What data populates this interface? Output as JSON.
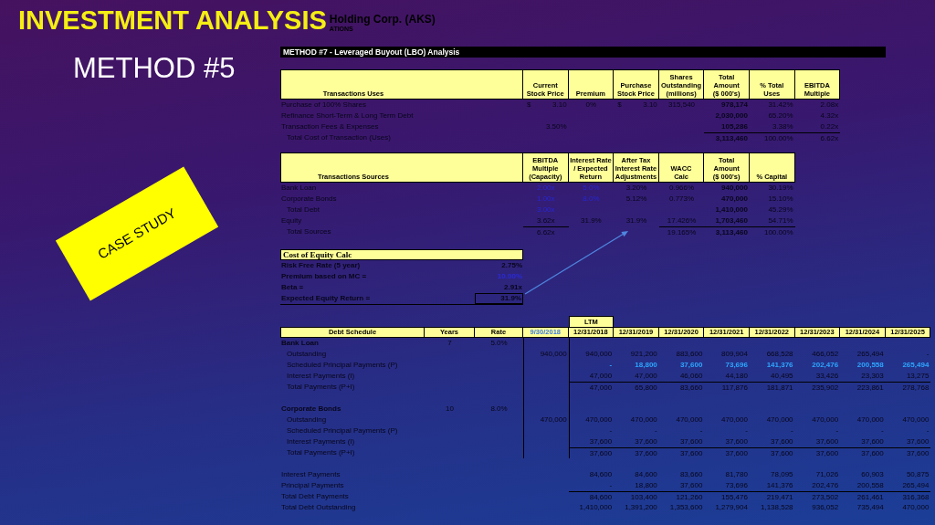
{
  "slide": {
    "title": "INVESTMENT ANALYSIS",
    "subtitle": "METHOD #5",
    "sticker": "CASE STUDY"
  },
  "sheet": {
    "company": "Holding Corp. (AKS)",
    "company_note": "ATIONS",
    "banner": "METHOD #7 - Leveraged Buyout (LBO) Analysis"
  },
  "uses": {
    "title": "Transactions Uses",
    "columns": [
      {
        "lines": [
          "Current",
          "Stock Price"
        ],
        "kind": "value"
      },
      {
        "lines": [
          "Premium"
        ],
        "kind": "center"
      },
      {
        "lines": [
          "Purchase",
          "Stock Price"
        ],
        "kind": "value"
      },
      {
        "lines": [
          "Shares",
          "Outstanding",
          "(millions)"
        ],
        "kind": "center"
      },
      {
        "lines": [
          "Total",
          "Amount",
          "($ 000's)"
        ],
        "kind": "total"
      },
      {
        "lines": [
          "% Total",
          "Uses"
        ],
        "kind": "value"
      },
      {
        "lines": [
          "EBITDA",
          "Multiple"
        ],
        "kind": "value"
      }
    ],
    "rows": [
      {
        "label": "Purchase of 100% Shares",
        "kind": "item",
        "cells": [
          {
            "symbol": "$",
            "text": "3.10"
          },
          "0%",
          {
            "symbol": "$",
            "text": "3.10"
          },
          "315,540",
          "978,174",
          "31.42%",
          "2.08x"
        ]
      },
      {
        "label": "Refinance Short-Term & Long Term Debt",
        "kind": "item",
        "cells": [
          null,
          null,
          null,
          null,
          "2,030,000",
          "65.20%",
          "4.32x"
        ]
      },
      {
        "label": "Transaction Fees & Expenses",
        "kind": "item",
        "cells": [
          "3.50%",
          null,
          null,
          null,
          "105,286",
          "3.38%",
          "0.22x"
        ]
      },
      {
        "label": "Total Cost of Transaction (Uses)",
        "kind": "total",
        "cells": [
          null,
          null,
          null,
          null,
          "3,113,460",
          "100.00%",
          "6.62x"
        ]
      }
    ]
  },
  "sources": {
    "title": "Transactions Sources",
    "columns": [
      {
        "lines": [
          "EBITDA",
          "Multiple",
          "(Capacity)"
        ],
        "kind": "center"
      },
      {
        "lines": [
          "Interest Rate",
          "/ Expected",
          "Return"
        ],
        "kind": "center"
      },
      {
        "lines": [
          "After Tax",
          "Interest Rate",
          "Adjustments"
        ],
        "kind": "center"
      },
      {
        "lines": [
          "WACC",
          "Calc"
        ],
        "kind": "center"
      },
      {
        "lines": [
          "Total",
          "Amount",
          "($ 000's)"
        ],
        "kind": "total"
      },
      {
        "lines": [
          "% Capital"
        ],
        "kind": "value"
      }
    ],
    "rows": [
      {
        "label": "Bank Loan",
        "kind": "item",
        "cells": [
          {
            "text": "2.00x",
            "kind": "input"
          },
          {
            "text": "5.0%",
            "kind": "input"
          },
          "3.20%",
          "0.966%",
          "940,000",
          "30.19%"
        ]
      },
      {
        "label": "Corporate Bonds",
        "kind": "item",
        "cells": [
          {
            "text": "1.00x",
            "kind": "input"
          },
          {
            "text": "8.0%",
            "kind": "input"
          },
          "5.12%",
          "0.773%",
          "470,000",
          "15.10%"
        ]
      },
      {
        "label": "Total Debt",
        "kind": "subtotal",
        "cells": [
          {
            "text": "3.00x",
            "kind": "input"
          },
          null,
          null,
          null,
          "1,410,000",
          "45.29%"
        ]
      },
      {
        "label": "Equity",
        "kind": "item",
        "cells": [
          "3.62x",
          "31.9%",
          "31.9%",
          "17.426%",
          "1,703,460",
          "54.71%"
        ]
      },
      {
        "label": "Total Sources",
        "kind": "total",
        "cells": [
          "6.62x",
          null,
          null,
          "19.165%",
          "3,113,460",
          "100.00%"
        ]
      }
    ]
  },
  "equity": {
    "title": "Cost of Equity Calc",
    "rows": [
      {
        "label": "Risk Free Rate (5 year)",
        "value": "2.75%",
        "kind": "item"
      },
      {
        "label": "Premium based on MC =",
        "value": "10.00%",
        "kind": "input"
      },
      {
        "label": "Beta =",
        "value": "2.91x",
        "kind": "item"
      },
      {
        "label": "Expected Equity Return =",
        "value": "31.9%",
        "kind": "result"
      }
    ]
  },
  "debt": {
    "title": "Debt Schedule",
    "param_headers": [
      "Years",
      "Rate"
    ],
    "columns": [
      {
        "label": "9/30/2018",
        "kind": "current"
      },
      {
        "label": "12/31/2018",
        "kind": "period",
        "group": "LTM"
      },
      {
        "label": "12/31/2019",
        "kind": "period"
      },
      {
        "label": "12/31/2020",
        "kind": "period"
      },
      {
        "label": "12/31/2021",
        "kind": "period"
      },
      {
        "label": "12/31/2022",
        "kind": "period"
      },
      {
        "label": "12/31/2023",
        "kind": "period"
      },
      {
        "label": "12/31/2024",
        "kind": "period"
      },
      {
        "label": "12/31/2025",
        "kind": "period"
      }
    ],
    "sections": [
      {
        "name": "Bank Loan",
        "years": "7",
        "rate": "5.0%",
        "rows": [
          {
            "label": "Outstanding",
            "kind": "item",
            "cells": [
              "940,000",
              "940,000",
              "921,200",
              "883,600",
              "809,904",
              "668,528",
              "466,052",
              "265,494",
              "-"
            ]
          },
          {
            "label": "Scheduled Principal Payments (P)",
            "kind": "highlight",
            "cells": [
              null,
              "-",
              "18,800",
              "37,600",
              "73,696",
              "141,376",
              "202,476",
              "200,558",
              "265,494"
            ]
          },
          {
            "label": "Interest Payments (I)",
            "kind": "item",
            "cells": [
              null,
              "47,000",
              "47,000",
              "46,060",
              "44,180",
              "40,495",
              "33,426",
              "23,303",
              "13,275"
            ]
          },
          {
            "label": "Total Payments (P+I)",
            "kind": "total",
            "cells": [
              null,
              "47,000",
              "65,800",
              "83,660",
              "117,876",
              "181,871",
              "235,902",
              "223,861",
              "278,768"
            ]
          }
        ]
      },
      {
        "name": "Corporate Bonds",
        "years": "10",
        "rate": "8.0%",
        "rows": [
          {
            "label": "Outstanding",
            "kind": "item",
            "cells": [
              "470,000",
              "470,000",
              "470,000",
              "470,000",
              "470,000",
              "470,000",
              "470,000",
              "470,000",
              "470,000"
            ]
          },
          {
            "label": "Scheduled Principal Payments (P)",
            "kind": "item",
            "cells": [
              null,
              "-",
              "-",
              "-",
              "-",
              "-",
              "-",
              "-",
              "-"
            ]
          },
          {
            "label": "Interest Payments (I)",
            "kind": "item",
            "cells": [
              null,
              "37,600",
              "37,600",
              "37,600",
              "37,600",
              "37,600",
              "37,600",
              "37,600",
              "37,600"
            ]
          },
          {
            "label": "Total Payments (P+I)",
            "kind": "total",
            "cells": [
              null,
              "37,600",
              "37,600",
              "37,600",
              "37,600",
              "37,600",
              "37,600",
              "37,600",
              "37,600"
            ]
          }
        ]
      }
    ],
    "summary": [
      {
        "label": "Interest Payments",
        "kind": "item",
        "cells": [
          null,
          "84,600",
          "84,600",
          "83,660",
          "81,780",
          "78,095",
          "71,026",
          "60,903",
          "50,875"
        ]
      },
      {
        "label": "Principal Payments",
        "kind": "item",
        "cells": [
          null,
          "-",
          "18,800",
          "37,600",
          "73,696",
          "141,376",
          "202,476",
          "200,558",
          "265,494"
        ]
      },
      {
        "label": "Total Debt Payments",
        "kind": "total",
        "cells": [
          null,
          "84,600",
          "103,400",
          "121,260",
          "155,476",
          "219,471",
          "273,502",
          "261,461",
          "316,368"
        ]
      },
      {
        "label": "Total Debt Outstanding",
        "kind": "item",
        "cells": [
          null,
          "1,410,000",
          "1,391,200",
          "1,353,600",
          "1,279,904",
          "1,138,528",
          "936,052",
          "735,494",
          "470,000"
        ]
      }
    ]
  }
}
